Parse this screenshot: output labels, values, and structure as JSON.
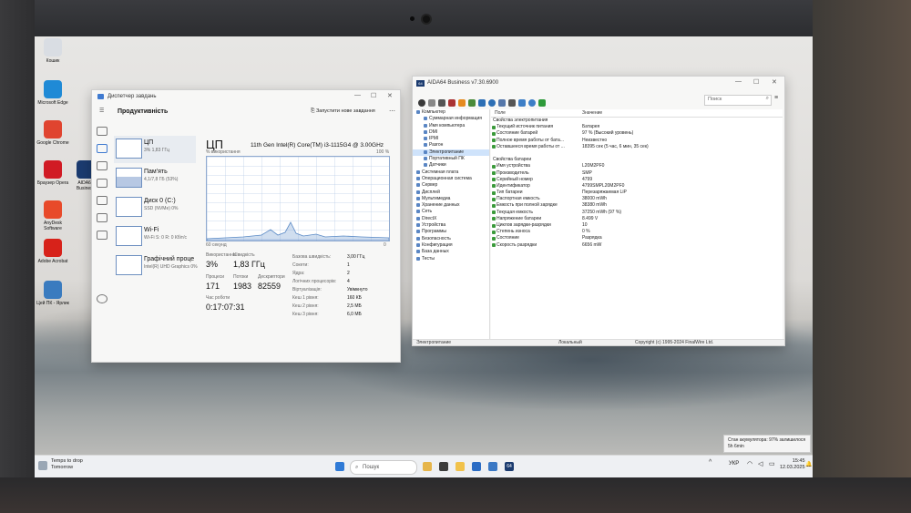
{
  "desktop": {
    "icons": [
      {
        "label": "Кошик",
        "color": "#d9dde3"
      },
      {
        "label": "Microsoft Edge",
        "color": "#1f8ad6"
      },
      {
        "label": "Google Chrome",
        "color": "#e0442f"
      },
      {
        "label": "Браузер Opera",
        "color": "#d11b24"
      },
      {
        "label": "AIDA64 Business",
        "color": "#1b3b6f"
      },
      {
        "label": "AnyDesk Software",
        "color": "#e84a2a"
      },
      {
        "label": "Adobe Acrobat",
        "color": "#d7221a"
      },
      {
        "label": "Цей ПК - Ярлик",
        "color": "#3a7bbf"
      }
    ]
  },
  "taskmgr": {
    "title": "Диспетчер завдань",
    "section": "Продуктивність",
    "run_task": "Запустити нове завдання",
    "items": [
      {
        "name": "ЦП",
        "sub": "3%  1,83 ГГц"
      },
      {
        "name": "Пам'ять",
        "sub": "4,1/7,8 ГБ (53%)"
      },
      {
        "name": "Диск 0 (C:)",
        "sub": "SSD (NVMe) 0%"
      },
      {
        "name": "Wi-Fi",
        "sub": "Wi-Fi S: 0 R: 0 Кбіт/с"
      },
      {
        "name": "Графічний проце",
        "sub": "Intel(R) UHD Graphics 0%"
      }
    ],
    "cpu_title": "ЦП",
    "cpu_model": "11th Gen Intel(R) Core(TM) i3-1115G4 @ 3.00GHz",
    "graph_label_left": "% використання",
    "graph_label_right": "100 %",
    "graph_bottom_left": "60 секунд",
    "graph_bottom_right": "0",
    "usage_label": "Використання",
    "usage_value": "3%",
    "speed_label": "Швидкість",
    "speed_value": "1,83 ГГц",
    "proc_label": "Процеси",
    "proc_value": "171",
    "threads_label": "Потоки",
    "threads_value": "1983",
    "handles_label": "Дескриптори",
    "handles_value": "82559",
    "uptime_label": "Час роботи",
    "uptime_value": "0:17:07:31",
    "specs": [
      {
        "k": "Базова швидкість:",
        "v": "3,00 ГГц"
      },
      {
        "k": "Сокети:",
        "v": "1"
      },
      {
        "k": "Ядра:",
        "v": "2"
      },
      {
        "k": "Логічних процесорів:",
        "v": "4"
      },
      {
        "k": "Віртуалізація:",
        "v": "Увімкнуто"
      },
      {
        "k": "Кеш 1 рівня:",
        "v": "160 КБ"
      },
      {
        "k": "Кеш 2 рівня:",
        "v": "2,5 МБ"
      },
      {
        "k": "Кеш 3 рівня:",
        "v": "6,0 МБ"
      }
    ]
  },
  "aida": {
    "title": "AIDA64 Business v7.30.6900",
    "search_placeholder": "Поиск",
    "col_field": "Поле",
    "col_value": "Значение",
    "tree": [
      {
        "t": "Компьютер",
        "sub": false,
        "sel": false
      },
      {
        "t": "Суммарная информация",
        "sub": true,
        "sel": false
      },
      {
        "t": "Имя компьютера",
        "sub": true,
        "sel": false
      },
      {
        "t": "DMI",
        "sub": true,
        "sel": false
      },
      {
        "t": "IPMI",
        "sub": true,
        "sel": false
      },
      {
        "t": "Разгон",
        "sub": true,
        "sel": false
      },
      {
        "t": "Электропитание",
        "sub": true,
        "sel": true
      },
      {
        "t": "Портативный ПК",
        "sub": true,
        "sel": false
      },
      {
        "t": "Датчики",
        "sub": true,
        "sel": false
      },
      {
        "t": "Системная плата",
        "sub": false,
        "sel": false
      },
      {
        "t": "Операционная система",
        "sub": false,
        "sel": false
      },
      {
        "t": "Сервер",
        "sub": false,
        "sel": false
      },
      {
        "t": "Дисплей",
        "sub": false,
        "sel": false
      },
      {
        "t": "Мультимедиа",
        "sub": false,
        "sel": false
      },
      {
        "t": "Хранение данных",
        "sub": false,
        "sel": false
      },
      {
        "t": "Сеть",
        "sub": false,
        "sel": false
      },
      {
        "t": "DirectX",
        "sub": false,
        "sel": false
      },
      {
        "t": "Устройства",
        "sub": false,
        "sel": false
      },
      {
        "t": "Программы",
        "sub": false,
        "sel": false
      },
      {
        "t": "Безопасность",
        "sub": false,
        "sel": false
      },
      {
        "t": "Конфигурация",
        "sub": false,
        "sel": false
      },
      {
        "t": "База данных",
        "sub": false,
        "sel": false
      },
      {
        "t": "Тесты",
        "sub": false,
        "sel": false
      }
    ],
    "rows": [
      {
        "f": "Свойства электропитания",
        "v": "",
        "group": true
      },
      {
        "f": "Текущий источник питания",
        "v": "Батарея",
        "group": false
      },
      {
        "f": "Состояние батарей",
        "v": "97 % (Высокий уровень)",
        "group": false
      },
      {
        "f": "Полное время работы от бата...",
        "v": "Неизвестно",
        "group": false
      },
      {
        "f": "Оставшееся время работы от ...",
        "v": "18395 сек (5 час, 6 мин, 35 сек)",
        "group": false
      },
      {
        "f": "",
        "v": "",
        "group": false
      },
      {
        "f": "Свойства батареи",
        "v": "",
        "group": true
      },
      {
        "f": "Имя устройства",
        "v": "L20M2PF0",
        "group": false
      },
      {
        "f": "Производитель",
        "v": "SMP",
        "group": false
      },
      {
        "f": "Серийный номер",
        "v": "4799",
        "group": false
      },
      {
        "f": "Идентификатор",
        "v": "4799SMPL20M2PF0",
        "group": false
      },
      {
        "f": "Тип батареи",
        "v": "Перезаряжаемая LiP",
        "group": false
      },
      {
        "f": "Паспортная емкость",
        "v": "38000 mWh",
        "group": false
      },
      {
        "f": "Емкость при полной зарядке",
        "v": "38380 mWh",
        "group": false
      },
      {
        "f": "Текущая емкость",
        "v": "37250 mWh  (97 %)",
        "group": false
      },
      {
        "f": "Напряжение батареи",
        "v": "8.499 V",
        "group": false
      },
      {
        "f": "Циклов зарядки-разрядки",
        "v": "10",
        "group": false
      },
      {
        "f": "Степень износа",
        "v": "0 %",
        "group": false
      },
      {
        "f": "Состояние",
        "v": "Разрядка",
        "group": false
      },
      {
        "f": "Скорость разрядки",
        "v": "6656 mW",
        "group": false
      }
    ],
    "status_left": "Электропитание",
    "status_mid": "Локальный",
    "status_right": "Copyright (c) 1995-2024 FinalWire Ltd."
  },
  "toast": {
    "line1": "Стан акумулятора: 97% залишилося",
    "line2": "5h 6min"
  },
  "taskbar": {
    "weather_line1": "Temps to drop",
    "weather_line2": "Tomorrow",
    "search": "Пошук",
    "lang": "УКР",
    "time": "15:45",
    "date": "12.03.2025"
  }
}
